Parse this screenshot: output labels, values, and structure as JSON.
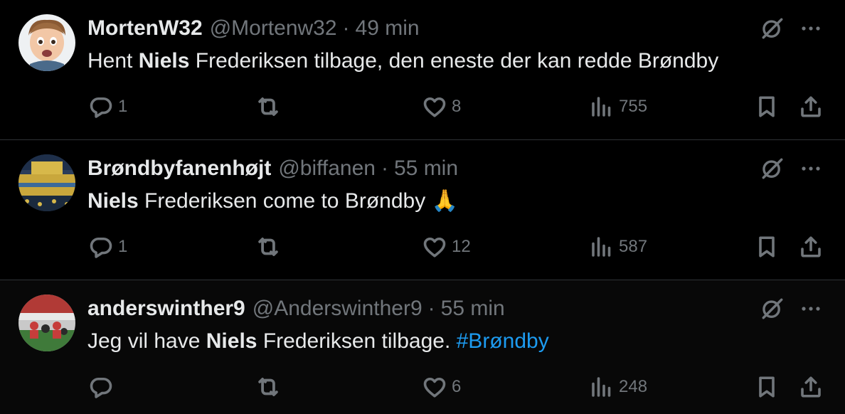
{
  "tweets": [
    {
      "name": "MortenW32",
      "handle": "@Mortenw32",
      "time": "49 min",
      "text_before": "Hent ",
      "text_bold": "Niels",
      "text_after": " Frederiksen tilbage, den eneste der kan redde Brøndby",
      "replies": "1",
      "reposts": "",
      "likes": "8",
      "views": "755",
      "avatar": "cartoon-boy"
    },
    {
      "name": "Brøndbyfanenhøjt",
      "handle": "@biffanen",
      "time": "55 min",
      "text_before": "",
      "text_bold": "Niels",
      "text_after": " Frederiksen come to Brøndby ",
      "emoji": "🙏",
      "replies": "1",
      "reposts": "",
      "likes": "12",
      "views": "587",
      "avatar": "stadium-crowd"
    },
    {
      "name": "anderswinther9",
      "handle": "@Anderswinther9",
      "time": "55 min",
      "text_before": "Jeg vil have ",
      "text_bold": "Niels",
      "text_after": " Frederiksen tilbage. ",
      "hashtag": "#Brøndby",
      "replies": "",
      "reposts": "",
      "likes": "6",
      "views": "248",
      "avatar": "football-celebration"
    }
  ],
  "separator": "·",
  "colors": {
    "background": "#000000",
    "text": "#e7e9ea",
    "muted": "#71767b",
    "link": "#1d9bf0",
    "border": "#2f3336"
  }
}
